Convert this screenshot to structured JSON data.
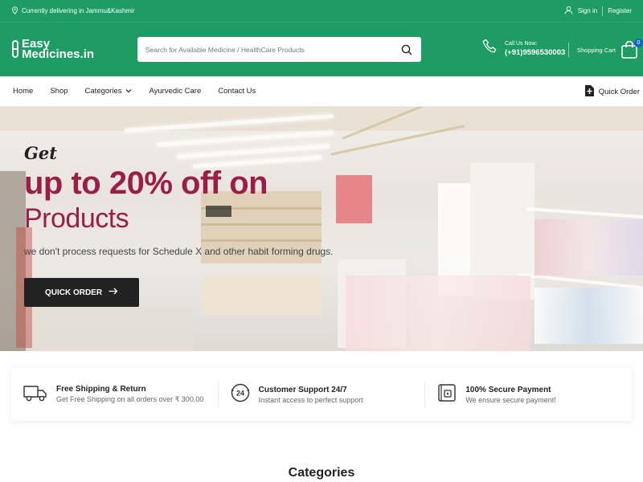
{
  "topbar": {
    "location_text": "Currently delivering in Jammu&Kashmir",
    "sign_in": "Sign in",
    "register": "Register"
  },
  "header": {
    "logo_line1": "Easy",
    "logo_line2": "Medicines.in",
    "search_placeholder": "Search for Available Medicine / HealthCare Products",
    "call_label": "Call Us Now:",
    "call_number": "(+91)9596530003",
    "cart_label": "Shopping Cart",
    "cart_count": "0"
  },
  "nav": {
    "items": [
      "Home",
      "Shop",
      "Categories",
      "Ayurvedic Care",
      "Contact Us"
    ],
    "quick_order": "Quick Order"
  },
  "hero": {
    "kicker": "Get",
    "headline": "up to 20% off on",
    "subheadline": "Products",
    "note": "we don't process requests for Schedule X and other habit forming drugs.",
    "cta": "QUICK ORDER"
  },
  "features": [
    {
      "icon": "truck-icon",
      "title": "Free Shipping & Return",
      "subtitle": "Get Free Shipping on all orders over ₹ 300.00"
    },
    {
      "icon": "support-24-icon",
      "title": "Customer Support 24/7",
      "subtitle": "Instant access to perfect support"
    },
    {
      "icon": "secure-wallet-icon",
      "title": "100% Secure Payment",
      "subtitle": "We ensure secure payment!"
    }
  ],
  "section_title": "Categories",
  "colors": {
    "brand_green": "#1e9c63",
    "headline": "#9a1f48",
    "button_dark": "#222222",
    "badge": "#1565c0"
  }
}
